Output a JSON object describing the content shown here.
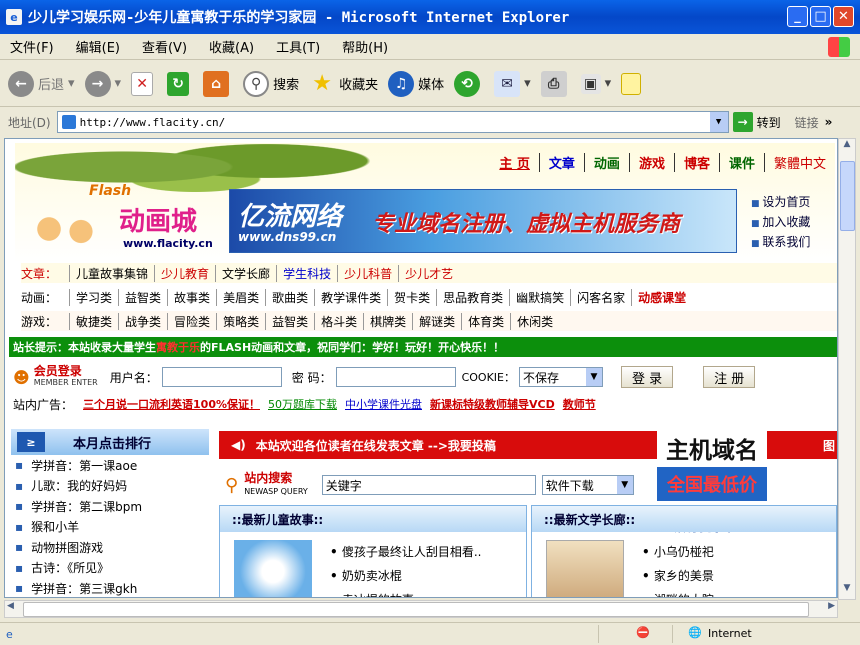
{
  "window": {
    "title": "少儿学习娱乐网-少年儿童寓教于乐的学习家园 - Microsoft Internet Explorer"
  },
  "menu": [
    "文件(F)",
    "编辑(E)",
    "查看(V)",
    "收藏(A)",
    "工具(T)",
    "帮助(H)"
  ],
  "toolbar": {
    "back": "后退",
    "search": "搜索",
    "favorites": "收藏夹",
    "media": "媒体"
  },
  "address": {
    "label": "地址(D)",
    "url": "http://www.flacity.cn/",
    "go": "转到",
    "links": "链接"
  },
  "site": {
    "logo_flash": "Flash",
    "logo_cn": "动画城",
    "logo_url": "www.flacity.cn",
    "topnav": [
      "主 页",
      "文章",
      "动画",
      "游戏",
      "博客",
      "课件",
      "繁體中文"
    ],
    "banner": {
      "brand": "亿流网络",
      "url": "www.dns99.cn",
      "slogan": "专业域名注册、虚拟主机服务商"
    },
    "sidelinks": [
      "设为首页",
      "加入收藏",
      "联系我们"
    ],
    "articles": {
      "label": "文章：",
      "items": [
        "儿童故事集锦",
        "少儿教育",
        "文学长廊",
        "学生科技",
        "少儿科普",
        "少儿才艺"
      ]
    },
    "animation": {
      "label": "动画：",
      "items": [
        "学习类",
        "益智类",
        "故事类",
        "美眉类",
        "歌曲类",
        "教学课件类",
        "贺卡类",
        "思品教育类",
        "幽默搞笑",
        "闪客名家",
        "动感课堂"
      ]
    },
    "games": {
      "label": "游戏：",
      "items": [
        "敏捷类",
        "战争类",
        "冒险类",
        "策略类",
        "益智类",
        "格斗类",
        "棋牌类",
        "解谜类",
        "体育类",
        "休闲类"
      ]
    },
    "tip": {
      "a": "站长提示：本站收录大量学生",
      "b": "寓教于乐",
      "c": "的FLASH动画和文章，祝同学们：学好！玩好！开心快乐！！"
    },
    "login": {
      "title": "会员登录",
      "sub": "MEMBER ENTER",
      "user": "用户名：",
      "pass": "密 码：",
      "cookie": "COOKIE：",
      "cookie_val": "不保存",
      "login_btn": "登 录",
      "register_btn": "注 册"
    },
    "ad": {
      "label": "站内广告：",
      "items": [
        "三个月说一口流利英语100%保证！",
        "50万题库下载",
        "中小学课件光盘",
        "新课标特级教师辅导VCD",
        "教师节"
      ]
    },
    "rank": {
      "title": "本月点击排行",
      "icon": "≥",
      "items": [
        "学拼音：第一课aoe",
        "儿歌：我的好妈妈",
        "学拼音：第二课bpm",
        "猴和小羊",
        "动物拼图游戏",
        "古诗：《所见》",
        "学拼音：第三课gkh"
      ]
    },
    "notice": {
      "text": "本站欢迎各位读者在线发表文章 -->我要投稿",
      "tail": "图"
    },
    "search": {
      "title": "站内搜索",
      "sub": "NEWASP QUERY",
      "keyword": "关键字",
      "type": "软件下载"
    },
    "promo": [
      "主机域名",
      "全国最低价",
      "诚招代理"
    ],
    "stories": {
      "title": "::最新儿童故事::",
      "items": [
        "傻孩子最终让人刮目相看..",
        "奶奶卖冰棍",
        "卖冰棍的故事"
      ]
    },
    "literature": {
      "title": "::最新文学长廊::",
      "items": [
        "小乌仍椪祀",
        "家乡的美景",
        "湖畔的大院"
      ]
    }
  },
  "status": {
    "zone": "Internet"
  }
}
